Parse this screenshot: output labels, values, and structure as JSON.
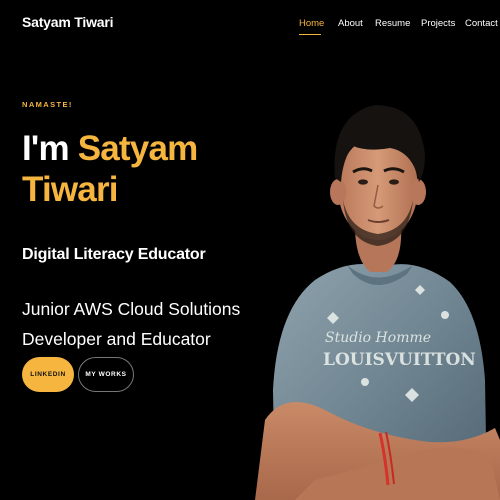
{
  "header": {
    "logo": "Satyam Tiwari",
    "nav": [
      {
        "label": "Home",
        "active": true
      },
      {
        "label": "About",
        "active": false
      },
      {
        "label": "Resume",
        "active": false
      },
      {
        "label": "Projects",
        "active": false
      },
      {
        "label": "Contact",
        "active": false
      }
    ]
  },
  "hero": {
    "greeting": "NAMASTE!",
    "title_prefix": "I'm",
    "title_first": "Satyam",
    "title_second": "Tiwari",
    "role": "Digital Literacy Educator",
    "description_line1": "Junior AWS Cloud Solutions",
    "description_line2": "Developer and Educator",
    "buttons": {
      "linkedin": "LINKEDIN",
      "works": "MY WORKS"
    },
    "photo_shirt_print_line1": "Studio Homme",
    "photo_shirt_print_line2": "LOUISVUITTON"
  },
  "colors": {
    "accent": "#f5b53f",
    "background": "#000000",
    "text": "#ffffff"
  }
}
